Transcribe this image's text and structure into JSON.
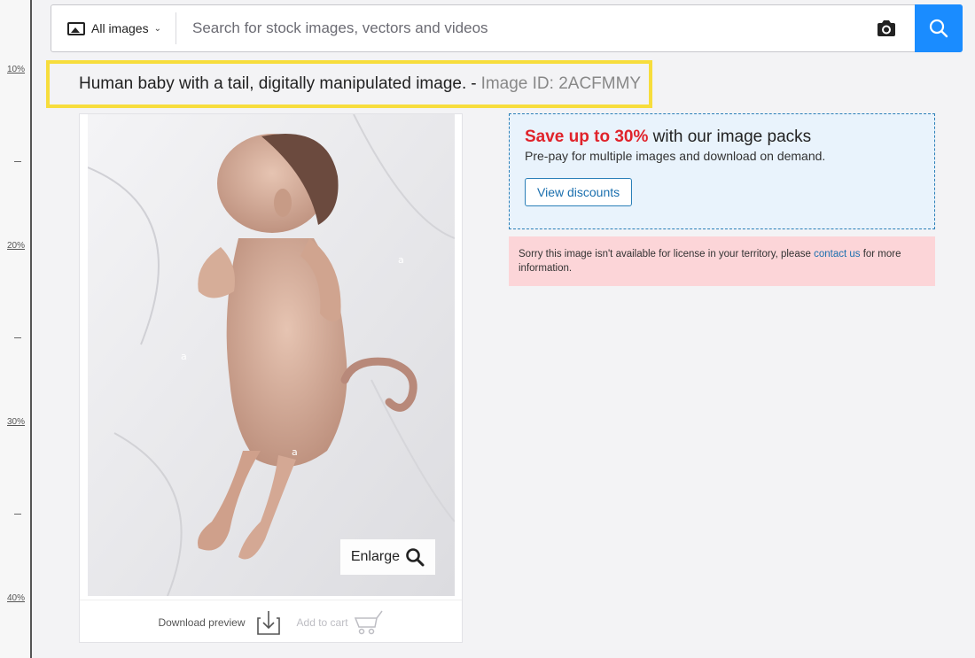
{
  "ruler": {
    "labels": [
      "10%",
      "20%",
      "30%",
      "40%"
    ]
  },
  "search": {
    "scope_label": "All images",
    "placeholder": "Search for stock images, vectors and videos",
    "value": ""
  },
  "title": {
    "main": "Human baby with a tail, digitally manipulated image.",
    "separator": "-",
    "image_id": "Image ID: 2ACFMMY"
  },
  "image_card": {
    "watermark": "a",
    "enlarge_label": "Enlarge",
    "download_label": "Download preview",
    "cart_label": "Add to cart"
  },
  "promo": {
    "highlight": "Save up to 30%",
    "heading_rest": " with our image packs",
    "subtext": "Pre-pay for multiple images and download on demand.",
    "button_label": "View discounts"
  },
  "alert": {
    "text_before": "Sorry this image isn't available for license in your territory, please ",
    "link_text": "contact us",
    "text_after": " for more information."
  },
  "colors": {
    "search_button": "#1a8cff",
    "highlight_border": "#f7dd3c",
    "promo_bg": "#e9f3fc",
    "promo_highlight": "#e0232b",
    "alert_bg": "#fcd5d8"
  }
}
